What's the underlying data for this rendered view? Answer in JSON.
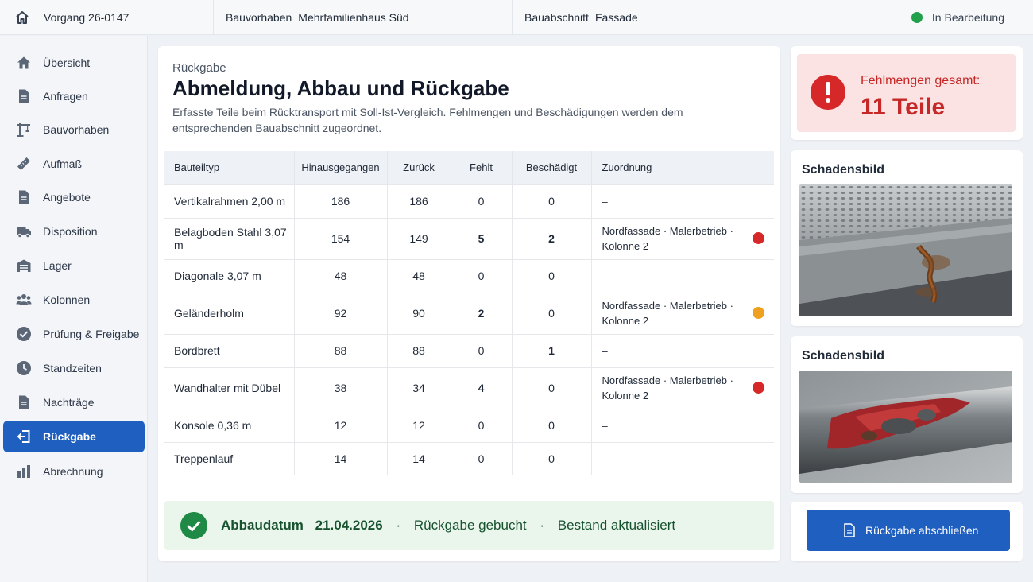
{
  "topbar": {
    "case": "Vorgang 26-0147",
    "project_label": "Bauvorhaben",
    "project_value": "Mehrfamilienhaus Süd",
    "section_label": "Bauabschnitt",
    "section_value": "Fassade",
    "status": "In Bearbeitung",
    "status_color": "#22a04b"
  },
  "sidebar": {
    "items": [
      {
        "label": "Übersicht",
        "icon": "home-icon"
      },
      {
        "label": "Anfragen",
        "icon": "document-icon"
      },
      {
        "label": "Bauvorhaben",
        "icon": "crane-icon"
      },
      {
        "label": "Aufmaß",
        "icon": "ruler-icon"
      },
      {
        "label": "Angebote",
        "icon": "document-icon"
      },
      {
        "label": "Disposition",
        "icon": "truck-icon"
      },
      {
        "label": "Lager",
        "icon": "warehouse-icon"
      },
      {
        "label": "Kolonnen",
        "icon": "people-icon"
      },
      {
        "label": "Prüfung & Freigabe",
        "icon": "check-circle-icon"
      },
      {
        "label": "Standzeiten",
        "icon": "clock-icon"
      },
      {
        "label": "Nachträge",
        "icon": "document-icon"
      },
      {
        "label": "Rückgabe",
        "icon": "return-icon",
        "active": true
      },
      {
        "label": "Abrechnung",
        "icon": "bar-chart-icon"
      }
    ],
    "active_color": "#1f5fbf"
  },
  "main": {
    "kicker": "Rückgabe",
    "title": "Abmeldung,  Abbau und Rückgabe",
    "description": "Erfasste Teile beim Rücktransport mit Soll-Ist-Vergleich. Fehlmengen und Beschädigungen werden dem entsprechenden Bauabschnitt zugeordnet.",
    "table": {
      "headers": [
        "Bauteiltyp",
        "Hinausgegangen",
        "Zurück",
        "Fehlt",
        "Beschädigt",
        "Zuordnung"
      ],
      "rows": [
        {
          "type": "Vertikalrahmen 2,00 m",
          "out": "186",
          "back": "186",
          "missing": "0",
          "damaged": "0",
          "assign_1": "–",
          "assign_2": ""
        },
        {
          "type": "Belagboden Stahl 3,07 m",
          "out": "154",
          "back": "149",
          "missing": "5",
          "damaged": "2",
          "assign_1": "Nordfassade · Malerbetrieb ·",
          "assign_2": "Kolonne 2",
          "flag": "red"
        },
        {
          "type": "Diagonale 3,07 m",
          "out": "48",
          "back": "48",
          "missing": "0",
          "damaged": "0",
          "assign_1": "–",
          "assign_2": ""
        },
        {
          "type": "Geländerholm",
          "out": "92",
          "back": "90",
          "missing": "2",
          "damaged": "0",
          "assign_1": "Nordfassade · Malerbetrieb ·",
          "assign_2": "Kolonne 2",
          "flag": "orange"
        },
        {
          "type": "Bordbrett",
          "out": "88",
          "back": "88",
          "missing": "0",
          "damaged": "1",
          "assign_1": "–",
          "assign_2": ""
        },
        {
          "type": "Wandhalter mit Dübel",
          "out": "38",
          "back": "34",
          "missing": "4",
          "damaged": "0",
          "assign_1": "Nordfassade · Malerbetrieb ·",
          "assign_2": "Kolonne 2",
          "flag": "red"
        },
        {
          "type": "Konsole 0,36 m",
          "out": "12",
          "back": "12",
          "missing": "0",
          "damaged": "0",
          "assign_1": "–",
          "assign_2": ""
        },
        {
          "type": "Treppenlauf",
          "out": "14",
          "back": "14",
          "missing": "0",
          "damaged": "0",
          "assign_1": "–",
          "assign_2": ""
        }
      ]
    },
    "banner": {
      "date_label": "Abbaudatum",
      "date_value": "21.04.2026",
      "status_1": "Rückgabe gebucht",
      "status_2": "Bestand aktualisiert",
      "separator": "·"
    }
  },
  "alert": {
    "label": "Fehlmengen gesamt:",
    "value": "11 Teile",
    "color": "#d62828"
  },
  "damage": [
    {
      "title": "Schadensbild",
      "image": "damaged-steel-deck-photo"
    },
    {
      "title": "Schadensbild",
      "image": "rusted-red-pipe-photo"
    }
  ],
  "action": {
    "label": "Rückgabe abschließen",
    "icon": "document-icon"
  },
  "colors": {
    "red": "#e53935",
    "orange": "#f0a020",
    "primary": "#1f5fbf",
    "success": "#1e8a45"
  }
}
